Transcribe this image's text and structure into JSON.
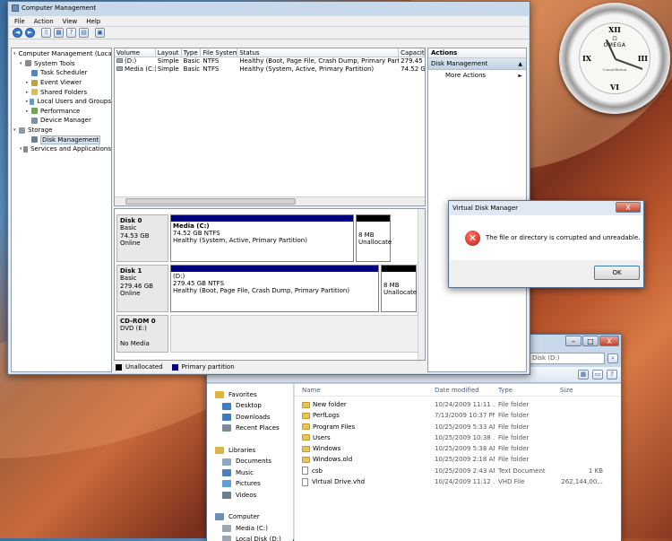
{
  "cm": {
    "title": "Computer Management",
    "menus": [
      "File",
      "Action",
      "View",
      "Help"
    ],
    "toolbar": [
      "back-icon",
      "forward-icon",
      "up-icon",
      "console-icon",
      "help-icon",
      "properties-icon",
      "export-icon"
    ],
    "tree": [
      {
        "label": "Computer Management (Local",
        "indent": 0,
        "icon": "computer-icon",
        "color": "#6d8fb5"
      },
      {
        "label": "System Tools",
        "indent": 1,
        "icon": "tools-icon",
        "color": "#8a8a8a"
      },
      {
        "label": "Task Scheduler",
        "indent": 2,
        "icon": "clock-icon",
        "color": "#4f83c4"
      },
      {
        "label": "Event Viewer",
        "indent": 2,
        "icon": "event-icon",
        "color": "#c7a23a"
      },
      {
        "label": "Shared Folders",
        "indent": 2,
        "icon": "shared-folder-icon",
        "color": "#e2bc4f"
      },
      {
        "label": "Local Users and Groups",
        "indent": 2,
        "icon": "users-icon",
        "color": "#5d9ad6"
      },
      {
        "label": "Performance",
        "indent": 2,
        "icon": "performance-icon",
        "color": "#6aa84f"
      },
      {
        "label": "Device Manager",
        "indent": 2,
        "icon": "device-icon",
        "color": "#7b8fa8"
      },
      {
        "label": "Storage",
        "indent": 0,
        "icon": "storage-icon",
        "color": "#8e9aa8"
      },
      {
        "label": "Disk Management",
        "indent": 2,
        "icon": "disk-icon",
        "color": "#6d7f95",
        "selected": true
      },
      {
        "label": "Services and Applications",
        "indent": 1,
        "icon": "services-icon",
        "color": "#8a8a8a"
      }
    ],
    "columns": [
      "Volume",
      "Layout",
      "Type",
      "File System",
      "Status",
      "Capacit"
    ],
    "volumes": [
      [
        "(D:)",
        "Simple",
        "Basic",
        "NTFS",
        "Healthy (Boot, Page File, Crash Dump, Primary Partition)",
        "279.45 C"
      ],
      [
        "Media (C:)",
        "Simple",
        "Basic",
        "NTFS",
        "Healthy (System, Active, Primary Partition)",
        "74.52 GE"
      ]
    ],
    "disks": [
      {
        "name": "Disk 0",
        "lines": [
          "Basic",
          "74.53 GB",
          "Online"
        ],
        "part_title": "Media  (C:)",
        "part_lines": [
          "74.52 GB NTFS",
          "Healthy (System, Active, Primary Partition)"
        ],
        "unalloc": [
          "8 MB",
          "Unallocate"
        ]
      },
      {
        "name": "Disk 1",
        "lines": [
          "Basic",
          "279.46 GB",
          "Online"
        ],
        "part_title": "(D:)",
        "part_lines": [
          "279.45 GB NTFS",
          "Healthy (Boot, Page File, Crash Dump, Primary Partition)"
        ],
        "unalloc": [
          "8 MB",
          "Unallocate"
        ]
      },
      {
        "name": "CD-ROM 0",
        "lines": [
          "DVD (E:)",
          "",
          "No Media"
        ]
      }
    ],
    "legend": [
      "Unallocated",
      "Primary partition"
    ],
    "actions": {
      "header": "Actions",
      "selected": "Disk Management",
      "more": "More Actions"
    },
    "colors": {
      "primary": "#00007f",
      "unallocated": "#000000",
      "selected": "#3399ff"
    }
  },
  "dialog": {
    "title": "Virtual Disk Manager",
    "message": "The file or directory is corrupted and unreadable.",
    "ok": "OK",
    "close": "X"
  },
  "explorer": {
    "address": "Disk (D:)",
    "nav": [
      {
        "label": "Favorites",
        "icon": "star-icon",
        "color": "#e2b638",
        "header": true
      },
      {
        "label": "Desktop",
        "icon": "desktop-icon",
        "color": "#3d7cc0"
      },
      {
        "label": "Downloads",
        "icon": "downloads-icon",
        "color": "#3d7cc0"
      },
      {
        "label": "Recent Places",
        "icon": "recent-icon",
        "color": "#7a8a9a"
      },
      {
        "label": "",
        "icon": "",
        "color": "transparent"
      },
      {
        "label": "Libraries",
        "icon": "library-icon",
        "color": "#d9b44a",
        "header": true
      },
      {
        "label": "Documents",
        "icon": "documents-icon",
        "color": "#8fa6c0"
      },
      {
        "label": "Music",
        "icon": "music-icon",
        "color": "#4a7fc4"
      },
      {
        "label": "Pictures",
        "icon": "pictures-icon",
        "color": "#5aa0d6"
      },
      {
        "label": "Videos",
        "icon": "videos-icon",
        "color": "#6a7d94"
      },
      {
        "label": "",
        "icon": "",
        "color": "transparent"
      },
      {
        "label": "Computer",
        "icon": "computer-icon",
        "color": "#6d8fb5",
        "header": true
      },
      {
        "label": "Media (C:)",
        "icon": "drive-icon",
        "color": "#9aa7b5"
      },
      {
        "label": "Local Disk (D:)",
        "icon": "drive-icon",
        "color": "#9aa7b5"
      }
    ],
    "columns": [
      "Name",
      "Date modified",
      "Type",
      "Size"
    ],
    "files": [
      {
        "name": "New folder",
        "date": "10/24/2009 11:11 ...",
        "type": "File folder",
        "size": "",
        "folder": true
      },
      {
        "name": "PerfLogs",
        "date": "7/13/2009 10:37 PM",
        "type": "File folder",
        "size": "",
        "folder": true
      },
      {
        "name": "Program Files",
        "date": "10/25/2009 5:33 AM",
        "type": "File folder",
        "size": "",
        "folder": true
      },
      {
        "name": "Users",
        "date": "10/25/2009 10:38 ...",
        "type": "File folder",
        "size": "",
        "folder": true
      },
      {
        "name": "Windows",
        "date": "10/25/2009 5:38 AM",
        "type": "File folder",
        "size": "",
        "folder": true
      },
      {
        "name": "Windows.old",
        "date": "10/25/2009 2:18 AM",
        "type": "File folder",
        "size": "",
        "folder": true
      },
      {
        "name": "csb",
        "date": "10/25/2009 2:43 AM",
        "type": "Text Document",
        "size": "1 KB",
        "folder": false
      },
      {
        "name": "Virtual Drive.vhd",
        "date": "10/24/2009 11:12 ...",
        "type": "VHD File",
        "size": "262,144,00...",
        "folder": false
      }
    ]
  },
  "clock": {
    "brand": "OMEGA",
    "sub": "Constellation",
    "numerals": [
      "XII",
      "III",
      "VI",
      "IX"
    ]
  }
}
